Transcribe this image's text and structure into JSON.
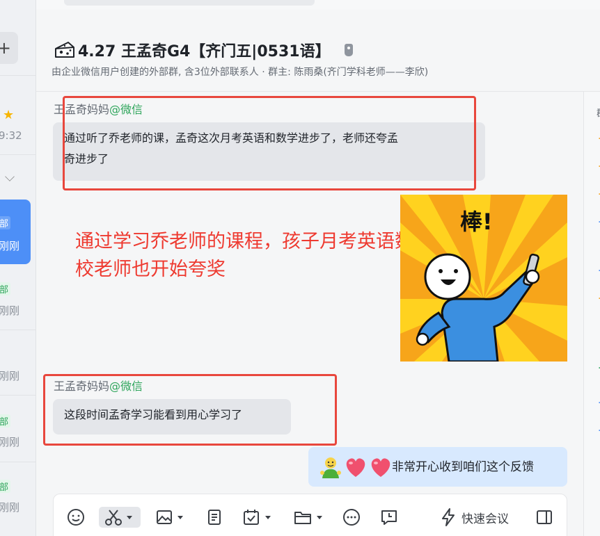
{
  "sidebar": {
    "plus_label": "+",
    "time_label": "9:32",
    "tag_label": "部",
    "sub_label": "刚刚"
  },
  "header": {
    "title": "4.27 王孟奇G4【齐门五|0531语】",
    "subtitle": "由企业微信用户创建的外部群, 含3位外部联系人 · 群主: 陈雨桑(齐门学科老师——李欣)"
  },
  "messages": [
    {
      "sender": "王孟奇妈妈",
      "source": "@微信",
      "text_line1": "通过听了乔老师的课，孟奇这次月考英语和数学进步了，老师还夸孟",
      "text_line2": "奇进步了"
    },
    {
      "sender": "王孟奇妈妈",
      "source": "@微信",
      "text": "这段时间孟奇学习能看到用心学习了"
    },
    {
      "text": "非常开心收到咱们这个反馈"
    }
  ],
  "annotation": {
    "line1": "通过学习乔老师的课程，孩子月考英语数学都有进步学",
    "line2": "校老师也开始夸奖"
  },
  "sticker": {
    "label": "棒!"
  },
  "toolbar": {
    "quick_meeting_label": "快速会议"
  },
  "colors": {
    "accent": "#4d8ff7",
    "annotation_red": "#ee3a30",
    "source_green": "#2ea55b"
  }
}
